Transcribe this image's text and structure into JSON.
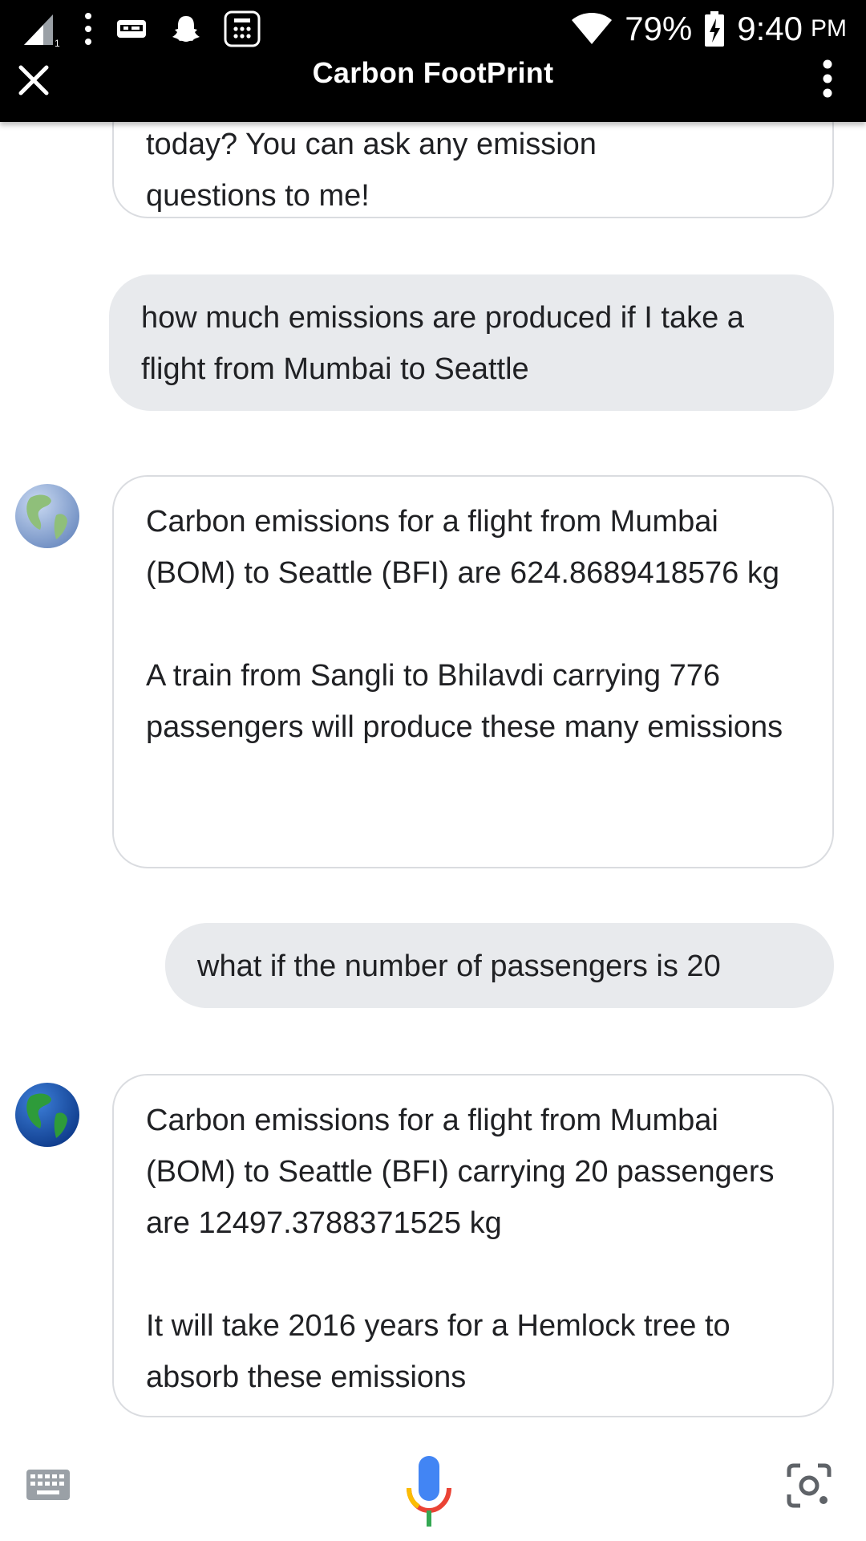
{
  "status_bar": {
    "battery": "79%",
    "time": "9:40",
    "ampm": "PM"
  },
  "app_bar": {
    "title": "Carbon FootPrint"
  },
  "messages": {
    "m0": {
      "lines": [
        "today? You can ask any emission",
        "questions to me!"
      ]
    },
    "m1": {
      "text": "how much emissions are produced if I take a flight from Mumbai to Seattle"
    },
    "m2": {
      "p1": "Carbon emissions for a flight from Mumbai (BOM) to Seattle (BFI) are 624.8689418576 kg",
      "p2": "A train from Sangli to Bhilavdi carrying 776 passengers will produce these many emissions"
    },
    "m3": {
      "text": "what if the number of passengers is 20"
    },
    "m4": {
      "p1": "Carbon emissions for a flight from Mumbai (BOM) to Seattle (BFI) carrying 20 passengers are 12497.3788371525 kg",
      "p2": "It will take 2016 years for a Hemlock tree to absorb these emissions"
    }
  },
  "icons": {
    "close": "close-icon",
    "menu": "more-vert-icon",
    "keyboard": "keyboard-icon",
    "mic": "mic-icon",
    "lens": "lens-icon",
    "avatar": "globe-icon"
  },
  "colors": {
    "topbar": "#000000",
    "bot_border": "#dadce0",
    "user_bubble": "#e8eaed",
    "mic_blue": "#4285f4",
    "mic_red": "#ea4335",
    "mic_yellow": "#fbbc05",
    "mic_green": "#34a853"
  }
}
